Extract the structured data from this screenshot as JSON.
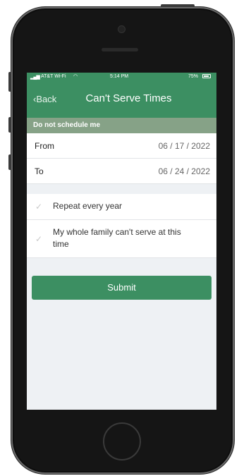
{
  "status_bar": {
    "carrier": "AT&T Wi-Fi",
    "time": "5:14 PM",
    "battery": "75%"
  },
  "nav": {
    "back_label": "Back",
    "title": "Can't Serve Times"
  },
  "section": {
    "header": "Do not schedule me"
  },
  "dates": {
    "from_label": "From",
    "from_value": "06 / 17 / 2022",
    "to_label": "To",
    "to_value": "06 / 24 / 2022"
  },
  "options": {
    "repeat_label": "Repeat every year",
    "family_label": "My whole family can't serve at this time",
    "repeat_checked": false,
    "family_checked": false
  },
  "actions": {
    "submit_label": "Submit"
  },
  "colors": {
    "primary": "#3c8f62",
    "section_header": "#86a287",
    "screen_bg": "#eef1f4"
  }
}
